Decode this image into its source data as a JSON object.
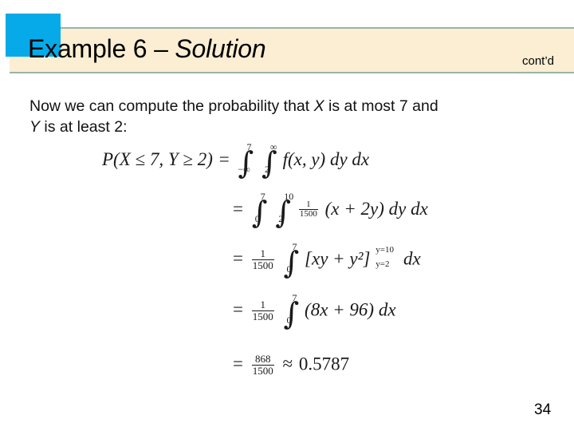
{
  "header": {
    "title_regular": "Example 6 – ",
    "title_italic": "Solution",
    "contd_label": "cont’d",
    "accent_color": "#06aae8",
    "band_color": "#fbeed2",
    "band_border_color": "#9ab3a6"
  },
  "body": {
    "line1_part1": "Now we can compute the probability that ",
    "line1_var": "X",
    "line1_part2": " is at most 7 and",
    "line2_var": "Y",
    "line2_part2": " is at least 2:"
  },
  "math": {
    "eq1": {
      "lhs": "P(X ≤ 7, Y ≥ 2)",
      "relation": "=",
      "outer_integral": {
        "lower": "−∞",
        "upper": "7"
      },
      "inner_integral": {
        "lower": "2",
        "upper": "∞"
      },
      "integrand": "f(x, y)",
      "differentials": "dy dx",
      "plain": "P(X ≤ 7, Y ≥ 2) = ∫₋∞⁷ ∫₂^∞ f(x, y) dy dx"
    },
    "eq2": {
      "relation": "=",
      "outer_integral": {
        "lower": "0",
        "upper": "7"
      },
      "inner_integral": {
        "lower": "2",
        "upper": "10"
      },
      "coefficient": {
        "numerator": "1",
        "denominator": "1500"
      },
      "integrand": "(x + 2y)",
      "differentials": "dy dx",
      "plain": "= ∫₀⁷ ∫₂¹⁰ (1/1500)(x + 2y) dy dx"
    },
    "eq3": {
      "relation": "=",
      "coefficient": {
        "numerator": "1",
        "denominator": "1500"
      },
      "integral": {
        "lower": "0",
        "upper": "7"
      },
      "bracket_expr": "[xy + y²]",
      "eval_upper": "y=10",
      "eval_lower": "y=2",
      "differentials": "dx",
      "plain": "= (1/1500) ∫₀⁷ [xy + y²] from y=2 to y=10 dx"
    },
    "eq4": {
      "relation": "=",
      "coefficient": {
        "numerator": "1",
        "denominator": "1500"
      },
      "integral": {
        "lower": "0",
        "upper": "7"
      },
      "integrand": "(8x + 96)",
      "differentials": "dx",
      "plain": "= (1/1500) ∫₀⁷ (8x + 96) dx"
    },
    "eq5": {
      "relation": "=",
      "fraction": {
        "numerator": "868",
        "denominator": "1500"
      },
      "approx": "≈",
      "value": "0.5787",
      "plain": "= 868/1500 ≈ 0.5787"
    }
  },
  "footer": {
    "page_number": "34"
  },
  "symbols": {
    "integral": "∫",
    "equals": "=",
    "approx": "≈",
    "plus": "+",
    "infinity": "∞",
    "minus_infinity": "−∞",
    "left_bracket": "[",
    "right_bracket": "]"
  }
}
